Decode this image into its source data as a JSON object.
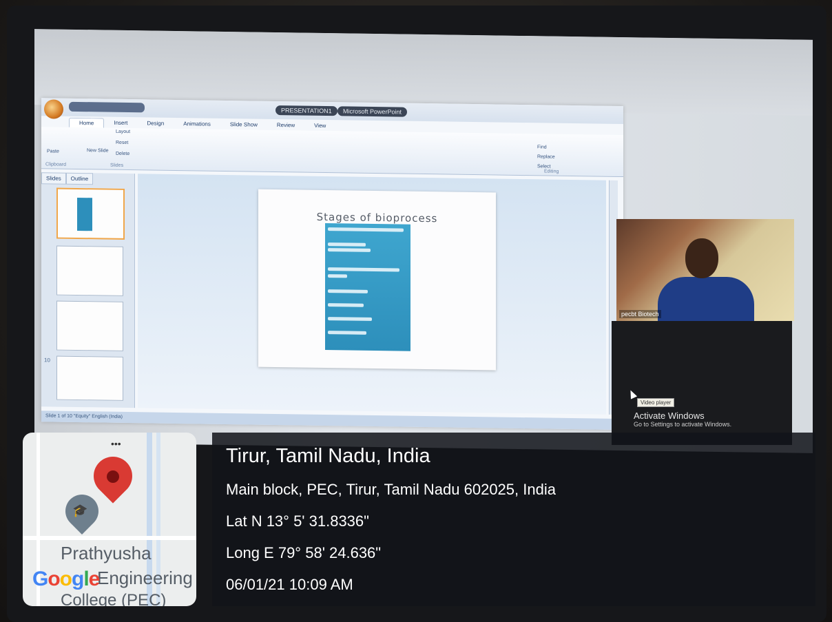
{
  "ppt": {
    "title_left": "PRESENTATION1",
    "title_right": "Microsoft PowerPoint",
    "tabs": [
      "Home",
      "Insert",
      "Design",
      "Animations",
      "Slide Show",
      "Review",
      "View"
    ],
    "ribbon": {
      "paste": "Paste",
      "clipboard": "Clipboard",
      "layout": "Layout",
      "reset": "Reset",
      "new_slide": "New Slide",
      "delete": "Delete",
      "slides_group": "Slides",
      "find": "Find",
      "replace": "Replace",
      "select": "Select",
      "editing": "Editing"
    },
    "panel_tabs": [
      "Slides",
      "Outline"
    ],
    "slide_numbers": [
      "",
      "",
      "",
      "10"
    ],
    "slide_title": "Stages of bioprocess",
    "status": "Slide 1 of 10    \"Equity\"    English (India)"
  },
  "video": {
    "participant_name": "pecbt Biotech"
  },
  "tooltip": "Video player",
  "activate": {
    "title": "Activate Windows",
    "subtitle": "Go to Settings to activate Windows."
  },
  "map": {
    "place_line1": "Prathyusha",
    "place_line2": "Engineering",
    "place_line3": "College (PEC)",
    "google": "Google"
  },
  "caption": {
    "location": "Tirur, Tamil Nadu, India",
    "address": "Main block, PEC, Tirur, Tamil Nadu 602025, India",
    "lat": "Lat N 13° 5' 31.8336\"",
    "long": "Long E 79° 58' 24.636\"",
    "datetime": "06/01/21 10:09 AM"
  }
}
